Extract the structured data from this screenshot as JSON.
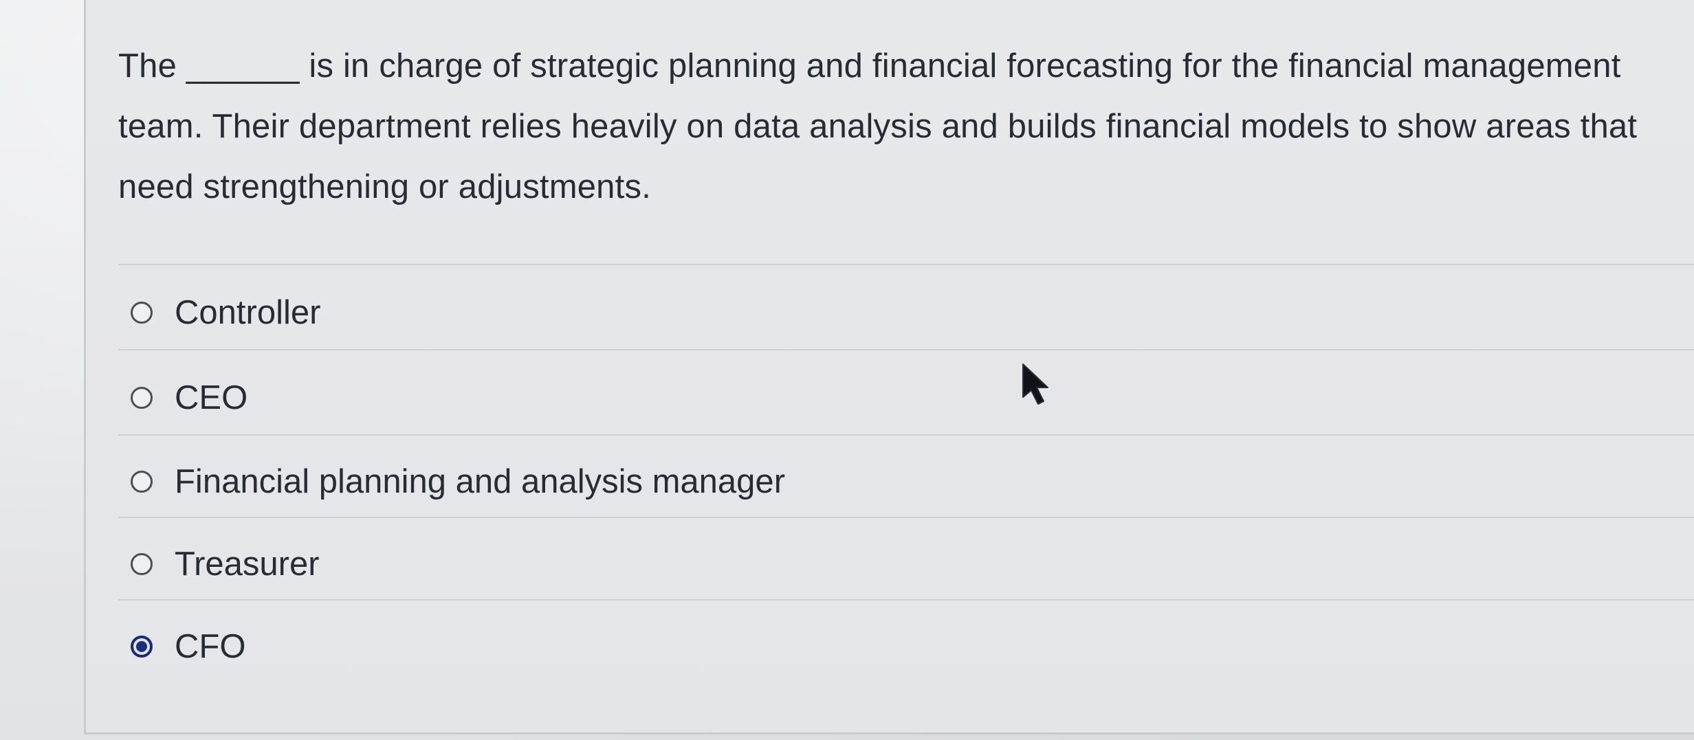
{
  "question": {
    "text": "The ______ is in charge of strategic planning and financial forecasting for the financial management team. Their department relies heavily on data analysis and builds financial models to show areas that need strengthening or adjustments."
  },
  "options": [
    {
      "label": "Controller",
      "selected": false
    },
    {
      "label": "CEO",
      "selected": false
    },
    {
      "label": "Financial planning and analysis manager",
      "selected": false
    },
    {
      "label": "Treasurer",
      "selected": false
    },
    {
      "label": "CFO",
      "selected": true
    }
  ],
  "colors": {
    "background": "#e6e7e9",
    "text": "#272b33",
    "radio_border": "#4a4e56",
    "radio_selected": "#1d2e7a",
    "divider": "#cfd1d5"
  },
  "icons": {
    "cursor": "arrow-pointer-icon",
    "radio": "radio-button-icon"
  }
}
